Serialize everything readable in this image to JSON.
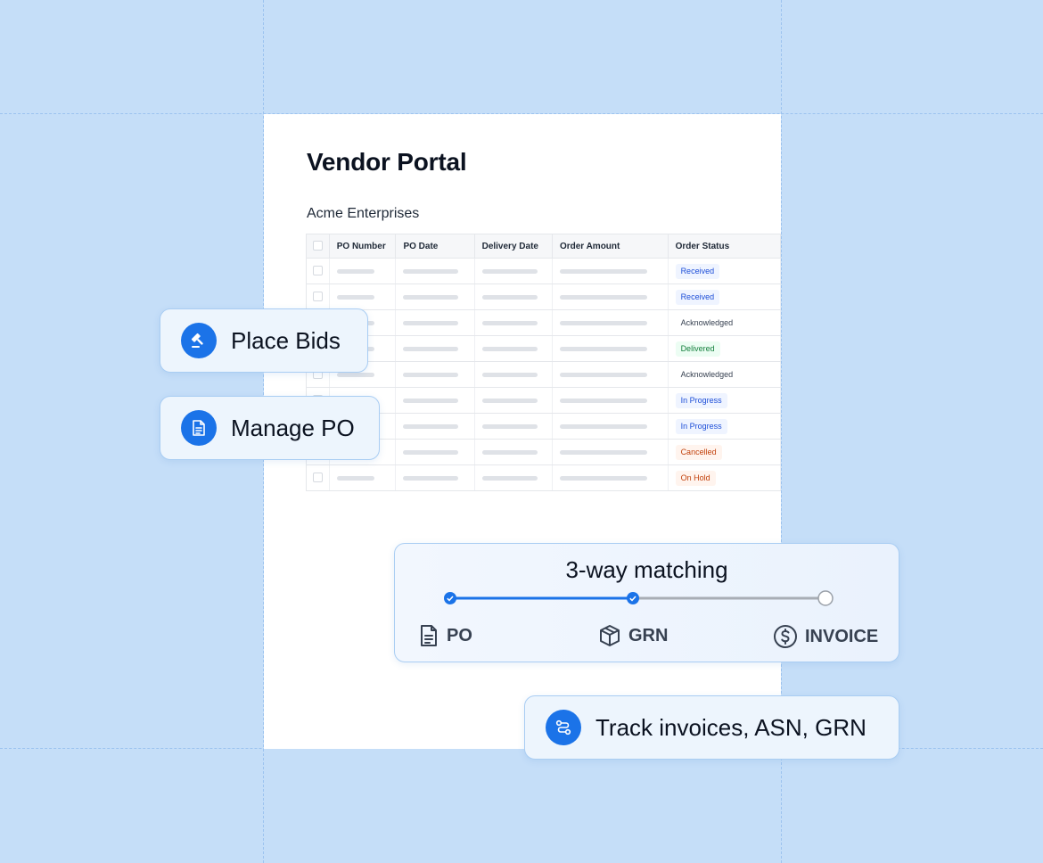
{
  "portal": {
    "title": "Vendor Portal",
    "company": "Acme Enterprises",
    "columns": [
      "PO Number",
      "PO Date",
      "Delivery Date",
      "Order Amount",
      "Order Status"
    ],
    "rows": [
      {
        "status": "Received",
        "color": "#1d4ed8",
        "bg": "#eff4ff"
      },
      {
        "status": "Received",
        "color": "#1d4ed8",
        "bg": "#eff4ff"
      },
      {
        "status": "Acknowledged",
        "color": "#374151",
        "bg": "#ffffff"
      },
      {
        "status": "Delivered",
        "color": "#15803d",
        "bg": "#ecfdf3"
      },
      {
        "status": "Acknowledged",
        "color": "#374151",
        "bg": "#ffffff"
      },
      {
        "status": "In Progress",
        "color": "#1d4ed8",
        "bg": "#eff4ff"
      },
      {
        "status": "In Progress",
        "color": "#1d4ed8",
        "bg": "#eff4ff"
      },
      {
        "status": "Cancelled",
        "color": "#c2410c",
        "bg": "#fff4ee"
      },
      {
        "status": "On Hold",
        "color": "#c2410c",
        "bg": "#fff4ee"
      }
    ]
  },
  "features": {
    "place_bids": "Place Bids",
    "manage_po": "Manage PO",
    "track": "Track invoices, ASN, GRN"
  },
  "matching": {
    "title": "3-way matching",
    "steps": [
      "PO",
      "GRN",
      "INVOICE"
    ],
    "completed_steps": 2
  },
  "colors": {
    "background": "#c5def8",
    "accent": "#1b73e8"
  }
}
